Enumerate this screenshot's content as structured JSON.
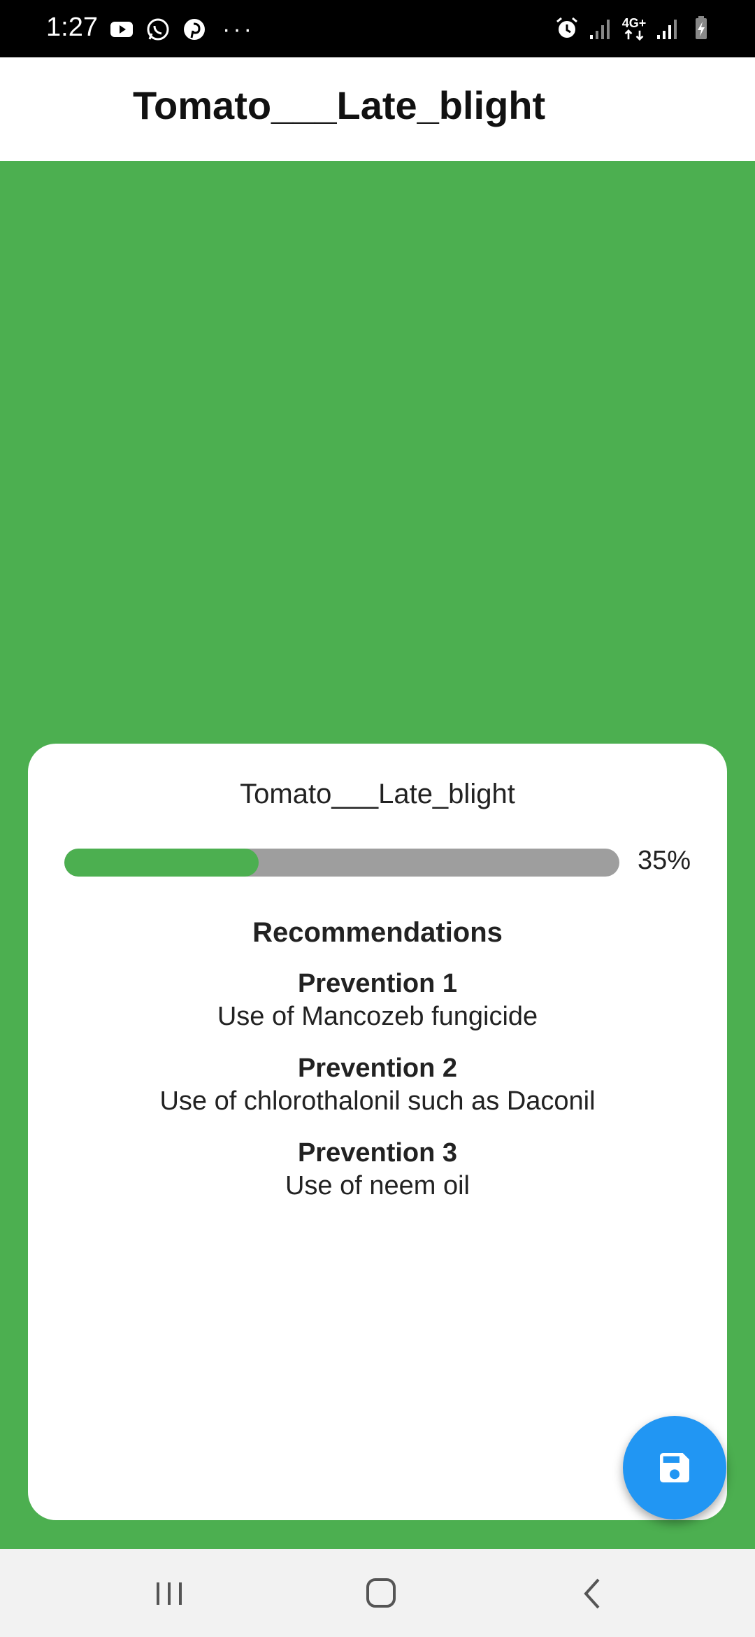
{
  "status_bar": {
    "time": "1:27",
    "left_icons": [
      "youtube-icon",
      "whatsapp-icon",
      "pinterest-icon"
    ],
    "overflow": "···",
    "network_label": "4G+",
    "right_icons": [
      "alarm-icon",
      "signal-icon",
      "data-icon",
      "signal-icon",
      "battery-icon"
    ]
  },
  "app_bar": {
    "title": "Tomato___Late_blight"
  },
  "result_card": {
    "disease_name": "Tomato___Late_blight",
    "confidence_percent": 35,
    "confidence_label": "35%",
    "recommendations_heading": "Recommendations",
    "recommendations": [
      {
        "title": "Prevention 1",
        "description": "Use of Mancozeb fungicide"
      },
      {
        "title": "Prevention 2",
        "description": "Use of chlorothalonil  such as Daconil"
      },
      {
        "title": "Prevention 3",
        "description": "Use of neem oil"
      }
    ]
  },
  "fab": {
    "icon": "save-icon"
  },
  "nav_bar": {
    "buttons": [
      "recent-apps-icon",
      "home-icon",
      "back-icon"
    ]
  },
  "colors": {
    "background": "#4CAF50",
    "progress_fill": "#4CAF50",
    "progress_track": "#9E9E9E",
    "fab": "#2196F3",
    "status_bar": "#000000",
    "nav_bar": "#F2F2F2"
  }
}
